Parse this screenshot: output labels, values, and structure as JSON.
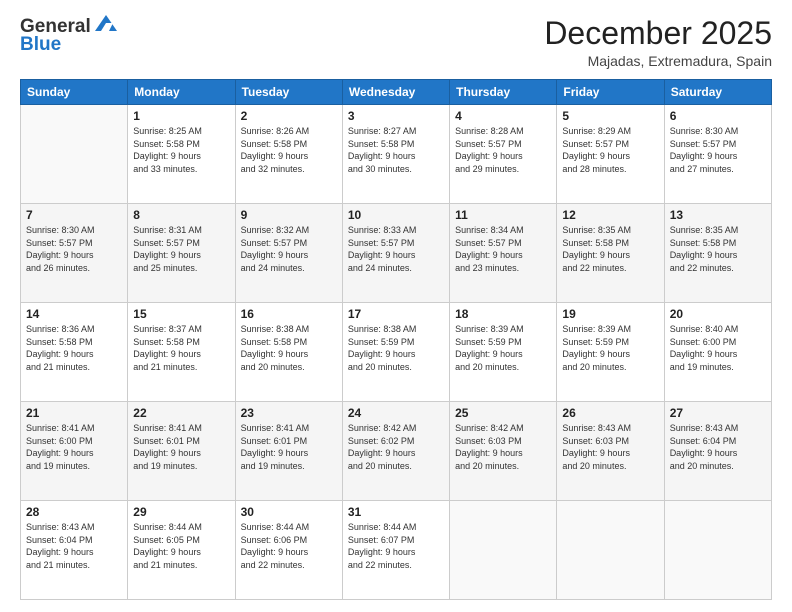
{
  "header": {
    "logo_line1": "General",
    "logo_line2": "Blue",
    "month": "December 2025",
    "location": "Majadas, Extremadura, Spain"
  },
  "weekdays": [
    "Sunday",
    "Monday",
    "Tuesday",
    "Wednesday",
    "Thursday",
    "Friday",
    "Saturday"
  ],
  "weeks": [
    [
      {
        "day": "",
        "info": ""
      },
      {
        "day": "1",
        "info": "Sunrise: 8:25 AM\nSunset: 5:58 PM\nDaylight: 9 hours\nand 33 minutes."
      },
      {
        "day": "2",
        "info": "Sunrise: 8:26 AM\nSunset: 5:58 PM\nDaylight: 9 hours\nand 32 minutes."
      },
      {
        "day": "3",
        "info": "Sunrise: 8:27 AM\nSunset: 5:58 PM\nDaylight: 9 hours\nand 30 minutes."
      },
      {
        "day": "4",
        "info": "Sunrise: 8:28 AM\nSunset: 5:57 PM\nDaylight: 9 hours\nand 29 minutes."
      },
      {
        "day": "5",
        "info": "Sunrise: 8:29 AM\nSunset: 5:57 PM\nDaylight: 9 hours\nand 28 minutes."
      },
      {
        "day": "6",
        "info": "Sunrise: 8:30 AM\nSunset: 5:57 PM\nDaylight: 9 hours\nand 27 minutes."
      }
    ],
    [
      {
        "day": "7",
        "info": "Sunrise: 8:30 AM\nSunset: 5:57 PM\nDaylight: 9 hours\nand 26 minutes."
      },
      {
        "day": "8",
        "info": "Sunrise: 8:31 AM\nSunset: 5:57 PM\nDaylight: 9 hours\nand 25 minutes."
      },
      {
        "day": "9",
        "info": "Sunrise: 8:32 AM\nSunset: 5:57 PM\nDaylight: 9 hours\nand 24 minutes."
      },
      {
        "day": "10",
        "info": "Sunrise: 8:33 AM\nSunset: 5:57 PM\nDaylight: 9 hours\nand 24 minutes."
      },
      {
        "day": "11",
        "info": "Sunrise: 8:34 AM\nSunset: 5:57 PM\nDaylight: 9 hours\nand 23 minutes."
      },
      {
        "day": "12",
        "info": "Sunrise: 8:35 AM\nSunset: 5:58 PM\nDaylight: 9 hours\nand 22 minutes."
      },
      {
        "day": "13",
        "info": "Sunrise: 8:35 AM\nSunset: 5:58 PM\nDaylight: 9 hours\nand 22 minutes."
      }
    ],
    [
      {
        "day": "14",
        "info": "Sunrise: 8:36 AM\nSunset: 5:58 PM\nDaylight: 9 hours\nand 21 minutes."
      },
      {
        "day": "15",
        "info": "Sunrise: 8:37 AM\nSunset: 5:58 PM\nDaylight: 9 hours\nand 21 minutes."
      },
      {
        "day": "16",
        "info": "Sunrise: 8:38 AM\nSunset: 5:58 PM\nDaylight: 9 hours\nand 20 minutes."
      },
      {
        "day": "17",
        "info": "Sunrise: 8:38 AM\nSunset: 5:59 PM\nDaylight: 9 hours\nand 20 minutes."
      },
      {
        "day": "18",
        "info": "Sunrise: 8:39 AM\nSunset: 5:59 PM\nDaylight: 9 hours\nand 20 minutes."
      },
      {
        "day": "19",
        "info": "Sunrise: 8:39 AM\nSunset: 5:59 PM\nDaylight: 9 hours\nand 20 minutes."
      },
      {
        "day": "20",
        "info": "Sunrise: 8:40 AM\nSunset: 6:00 PM\nDaylight: 9 hours\nand 19 minutes."
      }
    ],
    [
      {
        "day": "21",
        "info": "Sunrise: 8:41 AM\nSunset: 6:00 PM\nDaylight: 9 hours\nand 19 minutes."
      },
      {
        "day": "22",
        "info": "Sunrise: 8:41 AM\nSunset: 6:01 PM\nDaylight: 9 hours\nand 19 minutes."
      },
      {
        "day": "23",
        "info": "Sunrise: 8:41 AM\nSunset: 6:01 PM\nDaylight: 9 hours\nand 19 minutes."
      },
      {
        "day": "24",
        "info": "Sunrise: 8:42 AM\nSunset: 6:02 PM\nDaylight: 9 hours\nand 20 minutes."
      },
      {
        "day": "25",
        "info": "Sunrise: 8:42 AM\nSunset: 6:03 PM\nDaylight: 9 hours\nand 20 minutes."
      },
      {
        "day": "26",
        "info": "Sunrise: 8:43 AM\nSunset: 6:03 PM\nDaylight: 9 hours\nand 20 minutes."
      },
      {
        "day": "27",
        "info": "Sunrise: 8:43 AM\nSunset: 6:04 PM\nDaylight: 9 hours\nand 20 minutes."
      }
    ],
    [
      {
        "day": "28",
        "info": "Sunrise: 8:43 AM\nSunset: 6:04 PM\nDaylight: 9 hours\nand 21 minutes."
      },
      {
        "day": "29",
        "info": "Sunrise: 8:44 AM\nSunset: 6:05 PM\nDaylight: 9 hours\nand 21 minutes."
      },
      {
        "day": "30",
        "info": "Sunrise: 8:44 AM\nSunset: 6:06 PM\nDaylight: 9 hours\nand 22 minutes."
      },
      {
        "day": "31",
        "info": "Sunrise: 8:44 AM\nSunset: 6:07 PM\nDaylight: 9 hours\nand 22 minutes."
      },
      {
        "day": "",
        "info": ""
      },
      {
        "day": "",
        "info": ""
      },
      {
        "day": "",
        "info": ""
      }
    ]
  ]
}
